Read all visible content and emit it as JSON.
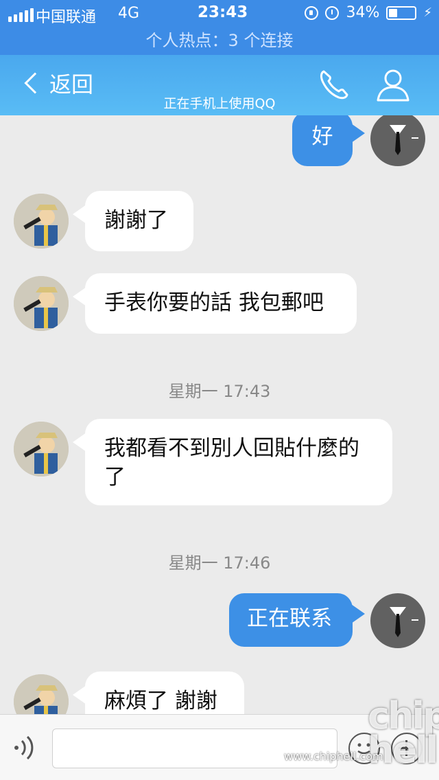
{
  "status_bar": {
    "carrier": "中国联通",
    "network": "4G",
    "time": "23:43",
    "battery_percent": "34%",
    "battery_level": 0.34
  },
  "hotspot": {
    "text": "个人热点：3 个连接"
  },
  "header": {
    "back_label": "返回",
    "subtitle": "正在手机上使用QQ"
  },
  "messages": [
    {
      "side": "out",
      "text": "好"
    },
    {
      "side": "in",
      "text": "謝謝了"
    },
    {
      "side": "in",
      "text": "手表你要的話 我包郵吧"
    },
    {
      "type": "time",
      "text": "星期一 17:43"
    },
    {
      "side": "in",
      "text": "我都看不到別人回貼什麼的了"
    },
    {
      "type": "time",
      "text": "星期一 17:46"
    },
    {
      "side": "out",
      "text": "正在联系"
    },
    {
      "side": "in",
      "text": "麻煩了 謝謝"
    }
  ],
  "watermark": {
    "logo": "chip hell",
    "url": "www.chiphell.com"
  },
  "icons": {
    "back": "chevron-left-icon",
    "call": "phone-icon",
    "profile": "person-icon",
    "voice": "voice-icon",
    "emoji": "emoji-icon",
    "more": "plus-icon"
  },
  "colors": {
    "header": "#4aa8ee",
    "status": "#3d8ce6",
    "bubble_out": "#3d90e6",
    "bubble_in": "#ffffff",
    "chat_bg": "#ebebeb"
  }
}
